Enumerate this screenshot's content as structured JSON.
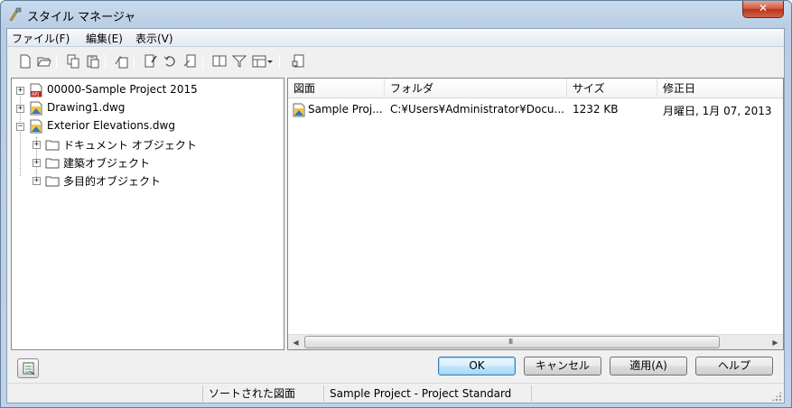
{
  "window": {
    "title": "スタイル マネージャ",
    "close_label": "✕"
  },
  "menu": [
    {
      "label": "ファイル(F)"
    },
    {
      "label": "編集(E)"
    },
    {
      "label": "表示(V)"
    }
  ],
  "toolbar_icons": [
    "new-icon",
    "open-icon",
    "copy-icon",
    "paste-icon",
    "purge-icon",
    "edit-style-icon",
    "refresh-icon",
    "set-from-icon",
    "toggle-view-icon",
    "filter-icon",
    "view-menu-icon",
    "dropdown-icon",
    "inquiry-icon"
  ],
  "tree": [
    {
      "label": "00000-Sample Project 2015",
      "icon": "apj-file-icon",
      "expander": "+"
    },
    {
      "label": "Drawing1.dwg",
      "icon": "dwg-file-icon",
      "expander": "+"
    },
    {
      "label": "Exterior Elevations.dwg",
      "icon": "dwg-file-icon",
      "expander": "−"
    },
    {
      "label": "ドキュメント オブジェクト",
      "icon": "folder-icon",
      "expander": "+"
    },
    {
      "label": "建築オブジェクト",
      "icon": "folder-icon",
      "expander": "+"
    },
    {
      "label": "多目的オブジェクト",
      "icon": "folder-icon",
      "expander": "+"
    }
  ],
  "list": {
    "columns": [
      "図面",
      "フォルダ",
      "サイズ",
      "修正日"
    ],
    "rows": [
      {
        "drawing": "Sample Proj...",
        "folder": "C:¥Users¥Administrator¥Docu...",
        "size": "1232 KB",
        "modified": "月曜日, 1月 07, 2013"
      }
    ],
    "scroll_grip": "III"
  },
  "buttons": {
    "ok": "OK",
    "cancel": "キャンセル",
    "apply": "適用(A)",
    "help": "ヘルプ"
  },
  "status": {
    "sorted": "ソートされた図面",
    "standard": "Sample Project - Project Standard"
  }
}
